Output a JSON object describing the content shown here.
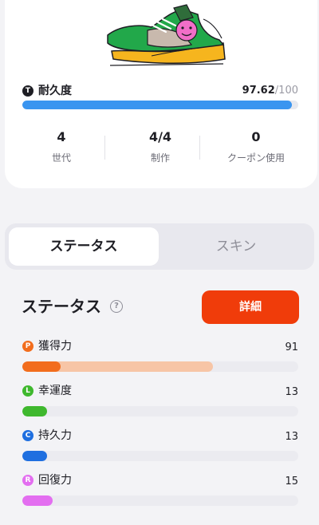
{
  "durability": {
    "label": "耐久度",
    "icon_letter": "T",
    "value": "97.62",
    "separator": "/",
    "max": "100",
    "fraction": 0.9762,
    "bar_color": "#3a95f0"
  },
  "summary": [
    {
      "value": "4",
      "label": "世代"
    },
    {
      "value": "4/4",
      "label": "制作"
    },
    {
      "value": "0",
      "label": "クーポン使用"
    }
  ],
  "tabs": [
    {
      "label": "ステータス",
      "active": true
    },
    {
      "label": "スキン",
      "active": false
    }
  ],
  "status_section": {
    "title": "ステータス",
    "help_icon": "?",
    "detail_button": "詳細"
  },
  "stats": [
    {
      "letter": "P",
      "label": "獲得力",
      "value": "91",
      "color": "#f26d1d",
      "potential_color": "#f7c5a6",
      "fill_fraction": 0.14,
      "potential_fraction": 0.69
    },
    {
      "letter": "L",
      "label": "幸運度",
      "value": "13",
      "color": "#3fb82e",
      "potential_color": "#cde9c7",
      "fill_fraction": 0.09,
      "potential_fraction": 0.0
    },
    {
      "letter": "C",
      "label": "持久力",
      "value": "13",
      "color": "#1f6fe0",
      "potential_color": "#c8d9f5",
      "fill_fraction": 0.09,
      "potential_fraction": 0.0
    },
    {
      "letter": "R",
      "label": "回復力",
      "value": "15",
      "color": "#e36ef0",
      "potential_color": "#f4cff8",
      "fill_fraction": 0.11,
      "potential_fraction": 0.0
    }
  ],
  "colors": {
    "accent": "#f03c0a",
    "background": "#f3f3f6"
  },
  "icons": {
    "sneaker": "sneaker-illustration",
    "help": "help-circle-icon"
  }
}
